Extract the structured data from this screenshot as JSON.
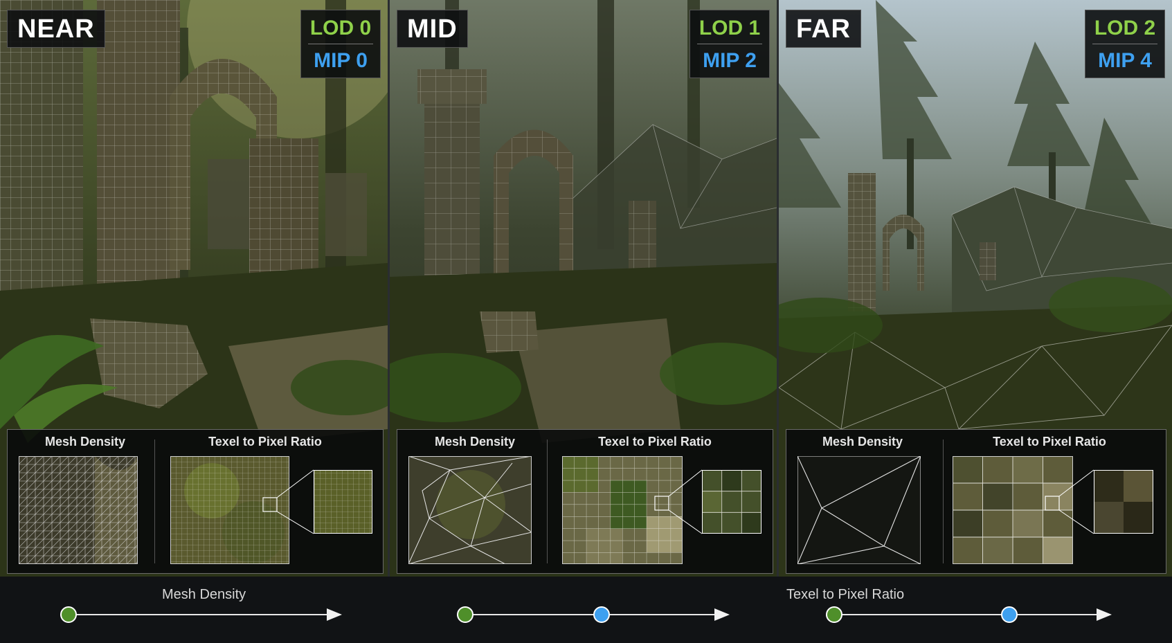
{
  "panels": [
    {
      "id": "near",
      "distance_label": "NEAR",
      "lod": "LOD 0",
      "mip": "MIP 0"
    },
    {
      "id": "mid",
      "distance_label": "MID",
      "lod": "LOD 1",
      "mip": "MIP 2"
    },
    {
      "id": "far",
      "distance_label": "FAR",
      "lod": "LOD 2",
      "mip": "MIP 4"
    }
  ],
  "insets": {
    "mesh_density_title": "Mesh Density",
    "texel_ratio_title": "Texel to Pixel Ratio"
  },
  "axis": {
    "mesh_density_label": "Mesh Density",
    "texel_ratio_label": "Texel to Pixel Ratio"
  },
  "colors": {
    "lod": "#8fd14a",
    "mip": "#3ea0f0",
    "dot_green": "#4f8f2a",
    "dot_blue": "#3ea0f0"
  }
}
